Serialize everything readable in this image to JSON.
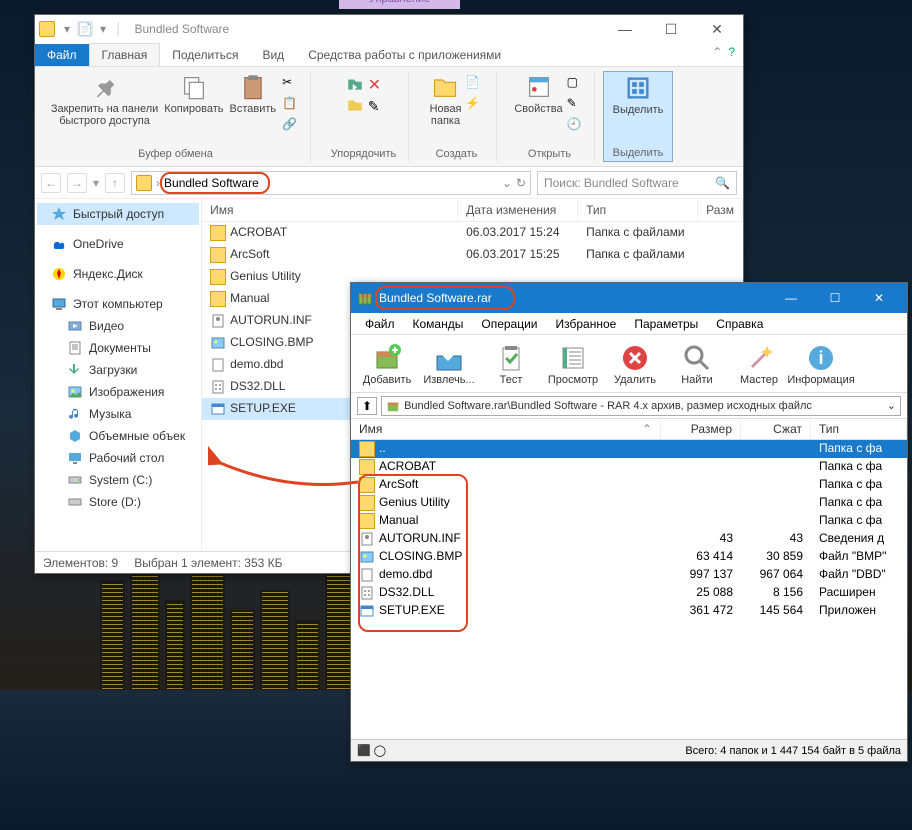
{
  "explorer": {
    "title": "Bundled Software",
    "ctx_tab": "Управление",
    "tabs": {
      "file": "Файл",
      "home": "Главная",
      "share": "Поделиться",
      "view": "Вид",
      "tools": "Средства работы с приложениями"
    },
    "ribbon": {
      "pin": "Закрепить на панели\nбыстрого доступа",
      "copy": "Копировать",
      "paste": "Вставить",
      "clipboard": "Буфер обмена",
      "organize": "Упорядочить",
      "new_folder": "Новая\nпапка",
      "create": "Создать",
      "props": "Свойства",
      "open": "Открыть",
      "select": "Выделить",
      "select_grp": "Выделить"
    },
    "address": {
      "folder": "Bundled Software"
    },
    "search_placeholder": "Поиск: Bundled Software",
    "nav": {
      "quick": "Быстрый доступ",
      "onedrive": "OneDrive",
      "yandex": "Яндекс.Диск",
      "this_pc": "Этот компьютер",
      "video": "Видео",
      "docs": "Документы",
      "downloads": "Загрузки",
      "pictures": "Изображения",
      "music": "Музыка",
      "volumes": "Объемные объек",
      "desktop": "Рабочий стол",
      "cdrive": "System (C:)",
      "ddrive": "Store (D:)"
    },
    "columns": {
      "name": "Имя",
      "date": "Дата изменения",
      "type": "Тип",
      "size": "Разм"
    },
    "rows": [
      {
        "name": "ACROBAT",
        "date": "06.03.2017 15:24",
        "type": "Папка с файлами",
        "is_folder": true
      },
      {
        "name": "ArcSoft",
        "date": "06.03.2017 15:25",
        "type": "Папка с файлами",
        "is_folder": true
      },
      {
        "name": "Genius Utility",
        "date": "",
        "type": "",
        "is_folder": true
      },
      {
        "name": "Manual",
        "date": "",
        "type": "",
        "is_folder": true
      },
      {
        "name": "AUTORUN.INF",
        "date": "",
        "type": "",
        "is_folder": false,
        "ext": "inf"
      },
      {
        "name": "CLOSING.BMP",
        "date": "",
        "type": "",
        "is_folder": false,
        "ext": "bmp"
      },
      {
        "name": "demo.dbd",
        "date": "",
        "type": "",
        "is_folder": false,
        "ext": "dbd"
      },
      {
        "name": "DS32.DLL",
        "date": "",
        "type": "",
        "is_folder": false,
        "ext": "dll"
      },
      {
        "name": "SETUP.EXE",
        "date": "",
        "type": "",
        "is_folder": false,
        "ext": "exe",
        "selected": true
      }
    ],
    "status": {
      "count": "Элементов: 9",
      "selection": "Выбран 1 элемент: 353 КБ"
    }
  },
  "winrar": {
    "title": "Bundled Software.rar",
    "menu": [
      "Файл",
      "Команды",
      "Операции",
      "Избранное",
      "Параметры",
      "Справка"
    ],
    "toolbar": [
      "Добавить",
      "Извлечь...",
      "Тест",
      "Просмотр",
      "Удалить",
      "Найти",
      "Мастер",
      "Информация"
    ],
    "address": "Bundled Software.rar\\Bundled Software - RAR 4.x архив, размер исходных файлс",
    "columns": {
      "name": "Имя",
      "size": "Размер",
      "packed": "Сжат",
      "type": "Тип"
    },
    "up_row": {
      "type": "Папка с фа"
    },
    "rows": [
      {
        "name": "ACROBAT",
        "size": "",
        "packed": "",
        "type": "Папка с фа",
        "is_folder": true
      },
      {
        "name": "ArcSoft",
        "size": "",
        "packed": "",
        "type": "Папка с фа",
        "is_folder": true
      },
      {
        "name": "Genius Utility",
        "size": "",
        "packed": "",
        "type": "Папка с фа",
        "is_folder": true
      },
      {
        "name": "Manual",
        "size": "",
        "packed": "",
        "type": "Папка с фа",
        "is_folder": true
      },
      {
        "name": "AUTORUN.INF",
        "size": "43",
        "packed": "43",
        "type": "Сведения д",
        "ext": "inf"
      },
      {
        "name": "CLOSING.BMP",
        "size": "63 414",
        "packed": "30 859",
        "type": "Файл \"BMP\"",
        "ext": "bmp"
      },
      {
        "name": "demo.dbd",
        "size": "997 137",
        "packed": "967 064",
        "type": "Файл \"DBD\"",
        "ext": "dbd"
      },
      {
        "name": "DS32.DLL",
        "size": "25 088",
        "packed": "8 156",
        "type": "Расширен",
        "ext": "dll"
      },
      {
        "name": "SETUP.EXE",
        "size": "361 472",
        "packed": "145 564",
        "type": "Приложен",
        "ext": "exe"
      }
    ],
    "status": {
      "total": "Всего: 4 папок и 1 447 154 байт в 5 файла"
    }
  }
}
